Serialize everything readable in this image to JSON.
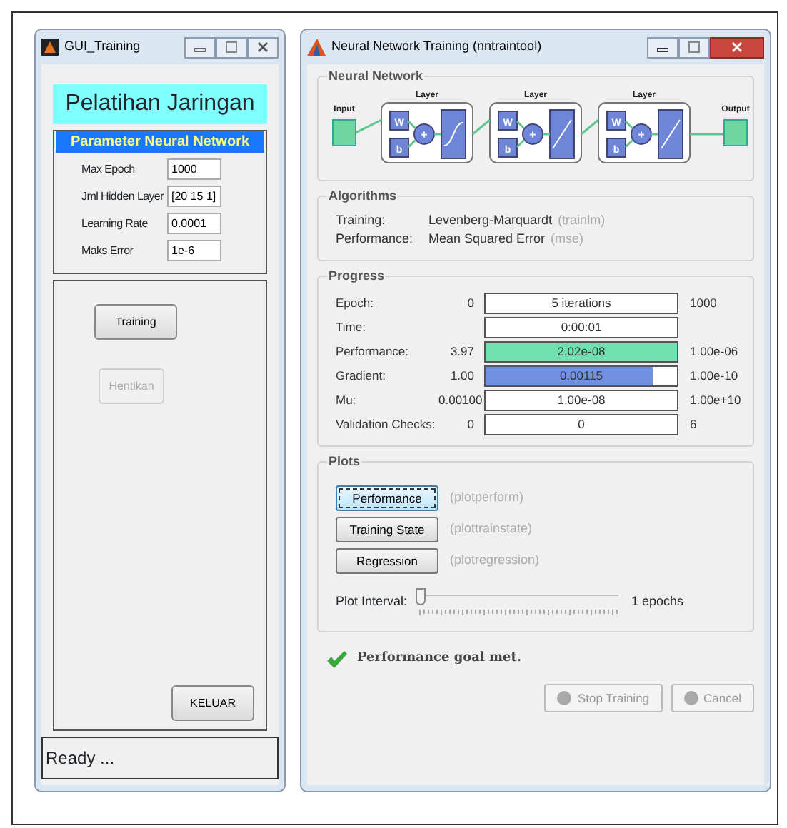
{
  "gui_window": {
    "title": "GUI_Training",
    "heading": "Pelatihan Jaringan",
    "panel_title": "Parameter Neural Network",
    "params": [
      {
        "label": "Max Epoch",
        "value": "1000"
      },
      {
        "label": "Jml Hidden Layer",
        "value": "[20 15 1]"
      },
      {
        "label": "Learning Rate",
        "value": "0.0001"
      },
      {
        "label": "Maks Error",
        "value": "1e-6"
      }
    ],
    "buttons": [
      {
        "label": "Training",
        "disabled": false
      },
      {
        "label": "Hentikan",
        "disabled": true
      }
    ],
    "exit_button": "KELUAR",
    "status": "Ready ..."
  },
  "nntraintool_window": {
    "title": "Neural Network Training (nntraintool)",
    "network": {
      "title": "Neural Network",
      "input_label": "Input",
      "output_label": "Output",
      "layers": [
        {
          "label": "Layer",
          "weight": "W",
          "bias": "b",
          "sum": "+",
          "kind": "sigmoid"
        },
        {
          "label": "Layer",
          "weight": "W",
          "bias": "b",
          "sum": "+",
          "kind": "linear"
        },
        {
          "label": "Layer",
          "weight": "W",
          "bias": "b",
          "sum": "+",
          "kind": "linear"
        }
      ]
    },
    "algorithms": {
      "title": "Algorithms",
      "rows": [
        {
          "label": "Training:",
          "value": "Levenberg-Marquardt",
          "code": "(trainlm)"
        },
        {
          "label": "Performance:",
          "value": "Mean Squared Error",
          "code": "(mse)"
        }
      ]
    },
    "progress": {
      "title": "Progress",
      "rows": [
        {
          "label": "Epoch:",
          "start": "0",
          "value": "5 iterations",
          "end": "1000"
        },
        {
          "label": "Time:",
          "value": "0:00:01"
        },
        {
          "label": "Performance:",
          "start": "3.97",
          "value": "2.02e-08",
          "end": "1.00e-06",
          "level": 1,
          "color": "#6fe0b0"
        },
        {
          "label": "Gradient:",
          "start": "1.00",
          "value": "0.00115",
          "end": "1.00e-10",
          "level": 0.87,
          "color": "#7090e0"
        },
        {
          "label": "Mu:",
          "start": "0.00100",
          "value": "1.00e-08",
          "end": "1.00e+10"
        },
        {
          "label": "Validation Checks:",
          "start": "0",
          "value": "0",
          "end": "6"
        }
      ]
    },
    "plots": {
      "title": "Plots",
      "buttons": [
        {
          "label": "Performance",
          "code": "(plotperform)",
          "focused": true
        },
        {
          "label": "Training State",
          "code": "(plottrainstate)",
          "focused": false
        },
        {
          "label": "Regression",
          "code": "(plotregression)",
          "focused": false
        }
      ],
      "interval": {
        "label": "Plot Interval:",
        "level": 0,
        "reading": "1 epochs"
      }
    },
    "status": "Performance goal met.",
    "buttons": [
      {
        "label": "Stop Training",
        "disabled": true
      },
      {
        "label": "Cancel",
        "disabled": true
      }
    ]
  }
}
